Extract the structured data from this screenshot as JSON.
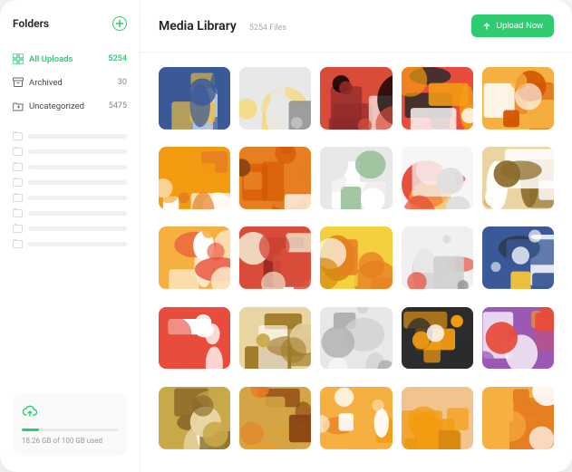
{
  "sidebar": {
    "title": "Folders",
    "folders": [
      {
        "label": "All Uploads",
        "count": "5254",
        "icon": "grid"
      },
      {
        "label": "Archived",
        "count": "30",
        "icon": "archive"
      },
      {
        "label": "Uncategorized",
        "count": "5475",
        "icon": "folder-plus"
      }
    ],
    "empty_folder_count": 8
  },
  "storage": {
    "text": "18.26 GB of 100 GB used",
    "percent": 18
  },
  "header": {
    "title": "Media Library",
    "subtitle": "5254 Files",
    "upload_label": "Upload Now"
  },
  "media_count": 25,
  "colors": {
    "accent": "#2ecc71"
  }
}
